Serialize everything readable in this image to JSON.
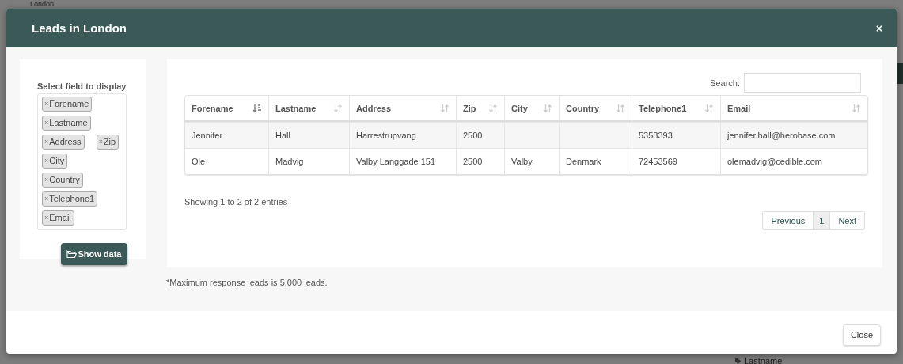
{
  "background": {
    "heading": "London",
    "tag": "Lastname"
  },
  "modal": {
    "title": "Leads in London",
    "close_icon": "×"
  },
  "field_picker": {
    "label": "Select field to display",
    "tags": [
      {
        "label": "Forename",
        "remove": "×"
      },
      {
        "label": "Lastname",
        "remove": "×"
      },
      {
        "label": "Address",
        "remove": "×"
      },
      {
        "label": "Zip",
        "remove": "×"
      },
      {
        "label": "City",
        "remove": "×"
      },
      {
        "label": "Country",
        "remove": "×"
      },
      {
        "label": "Telephone1",
        "remove": "×"
      },
      {
        "label": "Email",
        "remove": "×"
      }
    ],
    "button": "Show data"
  },
  "table": {
    "search_label": "Search:",
    "columns": [
      {
        "label": "Forename",
        "sorted": true
      },
      {
        "label": "Lastname",
        "sorted": false
      },
      {
        "label": "Address",
        "sorted": false
      },
      {
        "label": "Zip",
        "sorted": false
      },
      {
        "label": "City",
        "sorted": false
      },
      {
        "label": "Country",
        "sorted": false
      },
      {
        "label": "Telephone1",
        "sorted": false
      },
      {
        "label": "Email",
        "sorted": false
      }
    ],
    "rows": [
      [
        "Jennifer",
        "Hall",
        "Harrestrupvang",
        "2500",
        "",
        "",
        "5358393",
        "jennifer.hall@herobase.com"
      ],
      [
        "Ole",
        "Madvig",
        "Valby Langgade 151",
        "2500",
        "Valby",
        "Denmark",
        "72453569",
        "olemadvig@cedible.com"
      ]
    ],
    "info": "Showing 1 to 2 of 2 entries",
    "pagination": [
      {
        "label": "Previous",
        "selected": false
      },
      {
        "label": "1",
        "selected": true
      },
      {
        "label": "Next",
        "selected": false
      }
    ]
  },
  "note": "*Maximum response leads is 5,000 leads.",
  "footer": {
    "button": "Close"
  }
}
